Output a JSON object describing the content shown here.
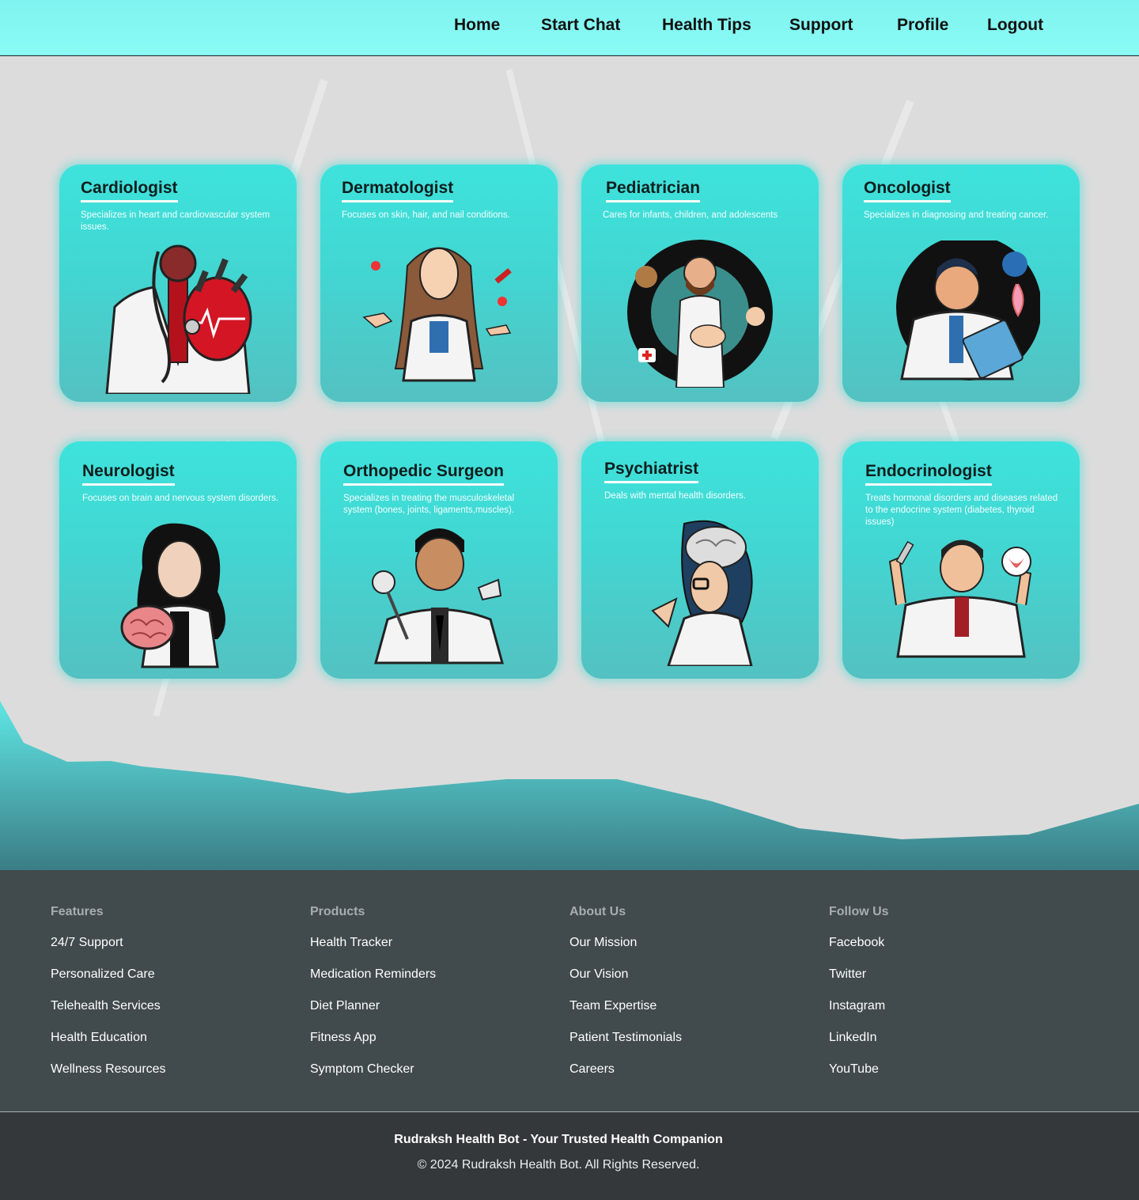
{
  "nav": {
    "items": [
      {
        "label": "Home"
      },
      {
        "label": "Start Chat"
      },
      {
        "label": "Health Tips"
      },
      {
        "label": "Support"
      },
      {
        "label": "Profile"
      },
      {
        "label": "Logout"
      }
    ]
  },
  "specialists": [
    {
      "title": "Cardiologist",
      "description": "Specializes in heart and cardiovascular system issues.",
      "icon": "cardiologist-illustration"
    },
    {
      "title": "Dermatologist",
      "description": "Focuses on skin, hair, and nail conditions.",
      "icon": "dermatologist-illustration"
    },
    {
      "title": "Pediatrician",
      "description": "Cares for infants, children, and adolescents",
      "icon": "pediatrician-illustration"
    },
    {
      "title": "Oncologist",
      "description": "Specializes in diagnosing and treating cancer.",
      "icon": "oncologist-illustration"
    },
    {
      "title": "Neurologist",
      "description": "Focuses on brain and nervous system disorders.",
      "icon": "neurologist-illustration"
    },
    {
      "title": "Orthopedic Surgeon",
      "description": "Specializes in treating the musculoskeletal system (bones, joints, ligaments,muscles).",
      "icon": "orthopedic-illustration"
    },
    {
      "title": "Psychiatrist",
      "description": "Deals with mental health disorders.",
      "icon": "psychiatrist-illustration"
    },
    {
      "title": "Endocrinologist",
      "description": "Treats hormonal disorders and diseases related to the endocrine system (diabetes, thyroid issues)",
      "icon": "endocrinologist-illustration"
    }
  ],
  "footer": {
    "columns": [
      {
        "heading": "Features",
        "links": [
          "24/7 Support",
          "Personalized Care",
          "Telehealth Services",
          "Health Education",
          "Wellness Resources"
        ]
      },
      {
        "heading": "Products",
        "links": [
          "Health Tracker",
          "Medication Reminders",
          "Diet Planner",
          "Fitness App",
          "Symptom Checker"
        ]
      },
      {
        "heading": "About Us",
        "links": [
          "Our Mission",
          "Our Vision",
          "Team Expertise",
          "Patient Testimonials",
          "Careers"
        ]
      },
      {
        "heading": "Follow Us",
        "links": [
          "Facebook",
          "Twitter",
          "Instagram",
          "LinkedIn",
          "YouTube"
        ]
      }
    ],
    "tagline": "Rudraksh Health Bot - Your Trusted Health Companion",
    "copyright": "© 2024 Rudraksh Health Bot. All Rights Reserved."
  },
  "colors": {
    "nav_bg": "#8afbf5",
    "card_bg": "#42d6d2",
    "footer_bg": "#414a4d",
    "bottom_bar_bg": "#35383a",
    "page_bg": "#dcdcdc"
  }
}
